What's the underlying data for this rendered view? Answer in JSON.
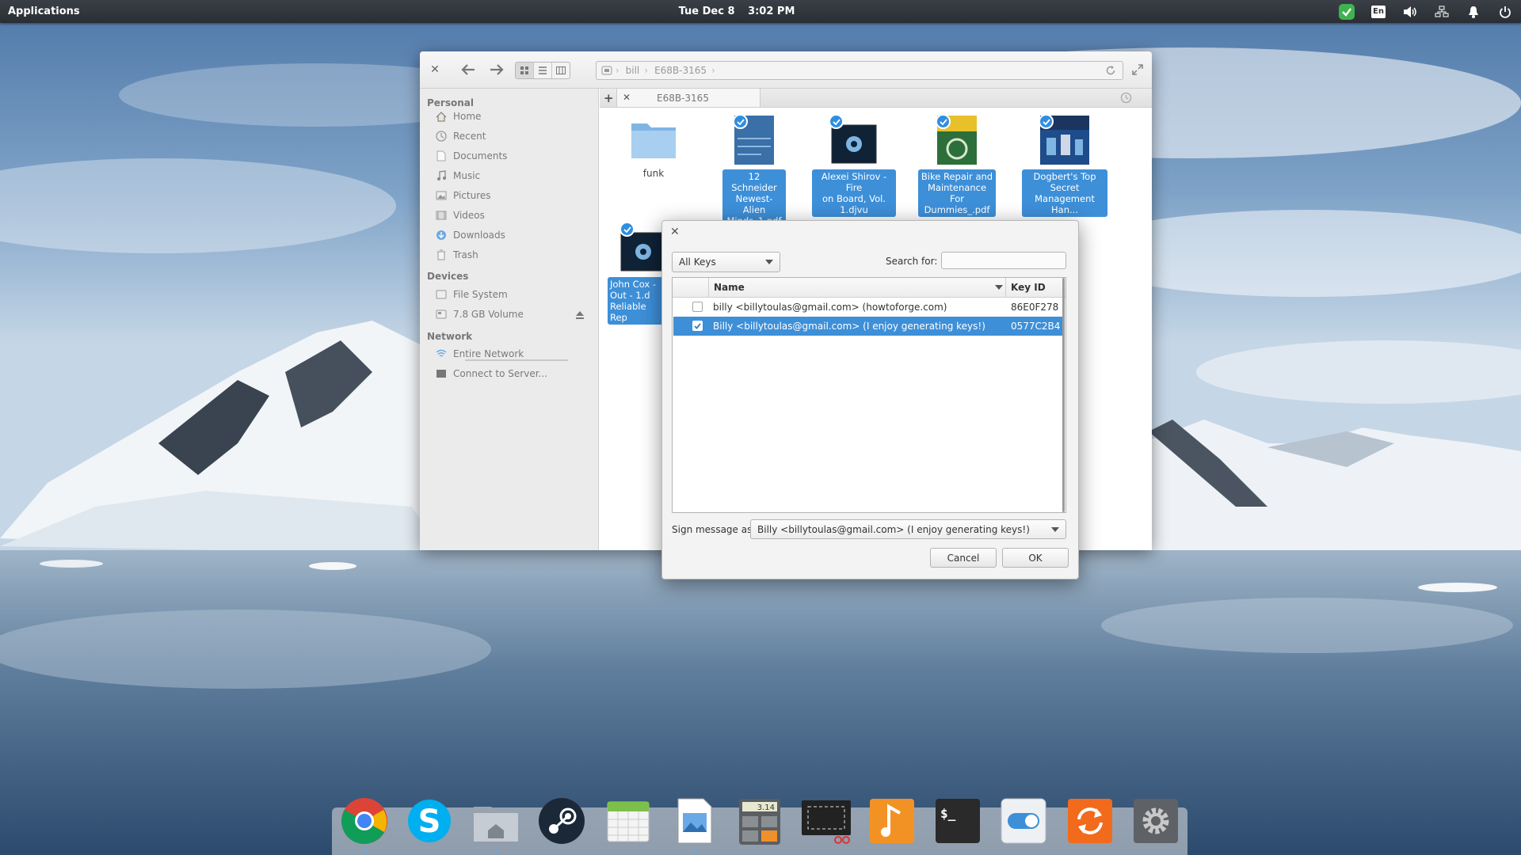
{
  "panel": {
    "applications": "Applications",
    "date": "Tue Dec  8",
    "time": "3:02 PM",
    "language": "En"
  },
  "file_manager": {
    "path": [
      "bill",
      "E68B-3165"
    ],
    "tab_title": "E68B-3165",
    "sidebar": {
      "personal_header": "Personal",
      "personal": [
        {
          "label": "Home",
          "icon": "home-icon"
        },
        {
          "label": "Recent",
          "icon": "recent-icon"
        },
        {
          "label": "Documents",
          "icon": "documents-icon"
        },
        {
          "label": "Music",
          "icon": "music-icon"
        },
        {
          "label": "Pictures",
          "icon": "pictures-icon"
        },
        {
          "label": "Videos",
          "icon": "videos-icon"
        },
        {
          "label": "Downloads",
          "icon": "downloads-icon"
        },
        {
          "label": "Trash",
          "icon": "trash-icon"
        }
      ],
      "devices_header": "Devices",
      "devices": [
        {
          "label": "File System",
          "icon": "drive-icon"
        },
        {
          "label": "7.8 GB Volume",
          "icon": "drive-icon"
        }
      ],
      "network_header": "Network",
      "network": [
        {
          "label": "Entire Network",
          "icon": "network-icon"
        },
        {
          "label": "Connect to Server...",
          "icon": "server-icon"
        }
      ]
    },
    "files": [
      {
        "name": "funk",
        "type": "folder",
        "selected": false
      },
      {
        "name": "12 Schneider Newest-Alien Minds_1.pdf",
        "type": "pdf",
        "selected": true
      },
      {
        "name": "Alexei Shirov - Fire on Board, Vol. 1.djvu",
        "type": "djvu",
        "selected": true
      },
      {
        "name": "Bike Repair and Maintenance For Dummies_.pdf",
        "type": "pdf",
        "selected": true
      },
      {
        "name": "Dogbert's Top Secret Management Han...",
        "type": "pdf",
        "selected": true
      },
      {
        "name": "John Cox - 1.d Out - 1.d Reliable Rep",
        "type": "djvu",
        "selected": true
      }
    ],
    "file_label_lines": [
      [
        "funk"
      ],
      [
        "12 Schneider",
        "Newest-Alien",
        "Minds_1.pdf"
      ],
      [
        "Alexei Shirov - Fire",
        "on Board, Vol.",
        "1.djvu"
      ],
      [
        "Bike Repair and",
        "Maintenance For",
        "Dummies_.pdf"
      ],
      [
        "Dogbert's Top",
        "Secret",
        "Management  Han..."
      ],
      [
        "John Cox -",
        "Out - 1.d",
        "Reliable Rep"
      ]
    ]
  },
  "dialog": {
    "filter": "All Keys",
    "search_label": "Search for:",
    "search_value": "",
    "columns": {
      "name": "Name",
      "key_id": "Key ID"
    },
    "keys": [
      {
        "name": "billy <billytoulas@gmail.com> (howtoforge.com)",
        "key_id": "86E0F278",
        "checked": false
      },
      {
        "name": "Billy <billytoulas@gmail.com> (I enjoy generating keys!)",
        "key_id": "0577C2B4",
        "checked": true
      }
    ],
    "sign_label": "Sign message as:",
    "sign_value": "Billy <billytoulas@gmail.com> (I enjoy generating keys!)",
    "cancel": "Cancel",
    "ok": "OK"
  },
  "dock": {
    "apps": [
      "chrome-icon",
      "skype-icon",
      "files-icon",
      "steam-icon",
      "calendar-icon",
      "photos-icon",
      "calculator-icon",
      "screenshot-icon",
      "music-icon",
      "terminal-icon",
      "switchboard-icon",
      "update-icon",
      "settings-icon"
    ],
    "calc_display": "3.14"
  },
  "colors": {
    "selection": "#3d8fd8",
    "panel": "#2f3339"
  }
}
